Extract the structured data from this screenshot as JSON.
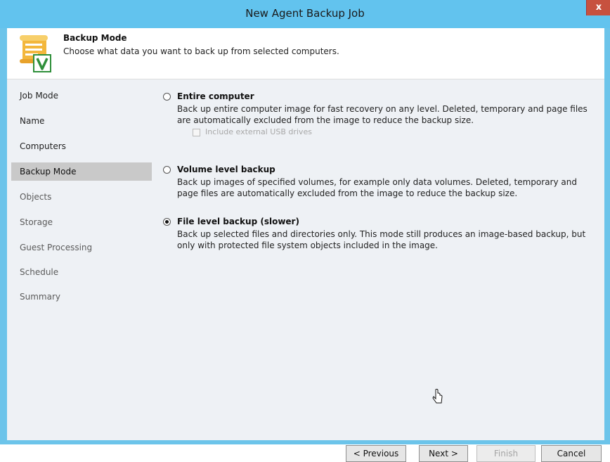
{
  "window": {
    "title": "New Agent Backup Job",
    "close_label": "x"
  },
  "header": {
    "title": "Backup Mode",
    "description": "Choose what data you want to back up from selected computers.",
    "icon": "backup-scroll-icon"
  },
  "sidebar": {
    "items": [
      {
        "label": "Job Mode",
        "state": "done"
      },
      {
        "label": "Name",
        "state": "done"
      },
      {
        "label": "Computers",
        "state": "done"
      },
      {
        "label": "Backup Mode",
        "state": "active"
      },
      {
        "label": "Objects",
        "state": "todo"
      },
      {
        "label": "Storage",
        "state": "todo"
      },
      {
        "label": "Guest Processing",
        "state": "todo"
      },
      {
        "label": "Schedule",
        "state": "todo"
      },
      {
        "label": "Summary",
        "state": "todo"
      }
    ]
  },
  "options": [
    {
      "title": "Entire computer",
      "description": "Back up entire computer image for fast recovery on any level. Deleted, temporary and page files are automatically excluded from the image to reduce the backup size.",
      "selected": false,
      "sub_option": {
        "label": "Include external USB drives",
        "checked": false,
        "enabled": false
      }
    },
    {
      "title": "Volume level backup",
      "description": "Back up images of specified volumes, for example only data volumes. Deleted, temporary and page files are automatically excluded from the image to reduce the backup size.",
      "selected": false
    },
    {
      "title": "File level backup (slower)",
      "description": "Back up selected files and directories only. This mode still produces an image-based backup, but only with protected file system objects included in the image.",
      "selected": true
    }
  ],
  "buttons": {
    "previous": "< Previous",
    "next": "Next >",
    "finish": "Finish",
    "cancel": "Cancel"
  }
}
